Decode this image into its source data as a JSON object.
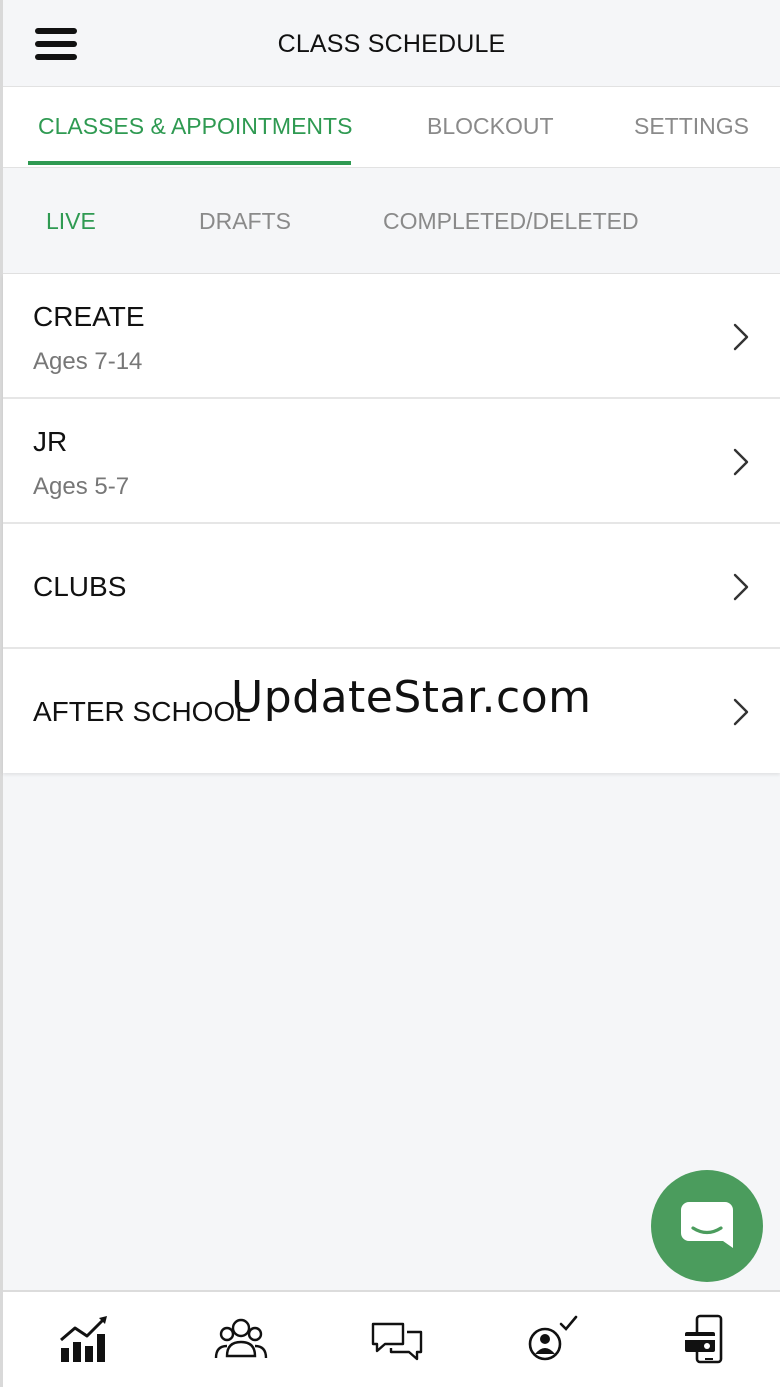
{
  "header": {
    "title": "CLASS SCHEDULE",
    "menu_icon": "hamburger-menu-icon"
  },
  "main_tabs": [
    {
      "label": "CLASSES & APPOINTMENTS",
      "active": true
    },
    {
      "label": "BLOCKOUT",
      "active": false
    },
    {
      "label": "SETTINGS",
      "active": false
    }
  ],
  "sub_tabs": [
    {
      "label": "LIVE",
      "active": true
    },
    {
      "label": "DRAFTS",
      "active": false
    },
    {
      "label": "COMPLETED/DELETED",
      "active": false
    }
  ],
  "classes": [
    {
      "title": "CREATE",
      "subtitle": "Ages 7-14"
    },
    {
      "title": "JR",
      "subtitle": "Ages 5-7"
    },
    {
      "title": "CLUBS",
      "subtitle": ""
    },
    {
      "title": "AFTER SCHOOL",
      "subtitle": ""
    }
  ],
  "watermark": "UpdateStar.com",
  "chat": {
    "icon": "chat-bubble-icon",
    "color": "#4b9c5d"
  },
  "bottom_nav": [
    {
      "icon": "analytics-chart-icon"
    },
    {
      "icon": "users-group-icon"
    },
    {
      "icon": "messages-icon"
    },
    {
      "icon": "attendance-check-icon"
    },
    {
      "icon": "payments-device-icon"
    }
  ],
  "colors": {
    "accent": "#2f9a52",
    "inactive_text": "#8a8a8a",
    "background": "#f5f6f8"
  }
}
